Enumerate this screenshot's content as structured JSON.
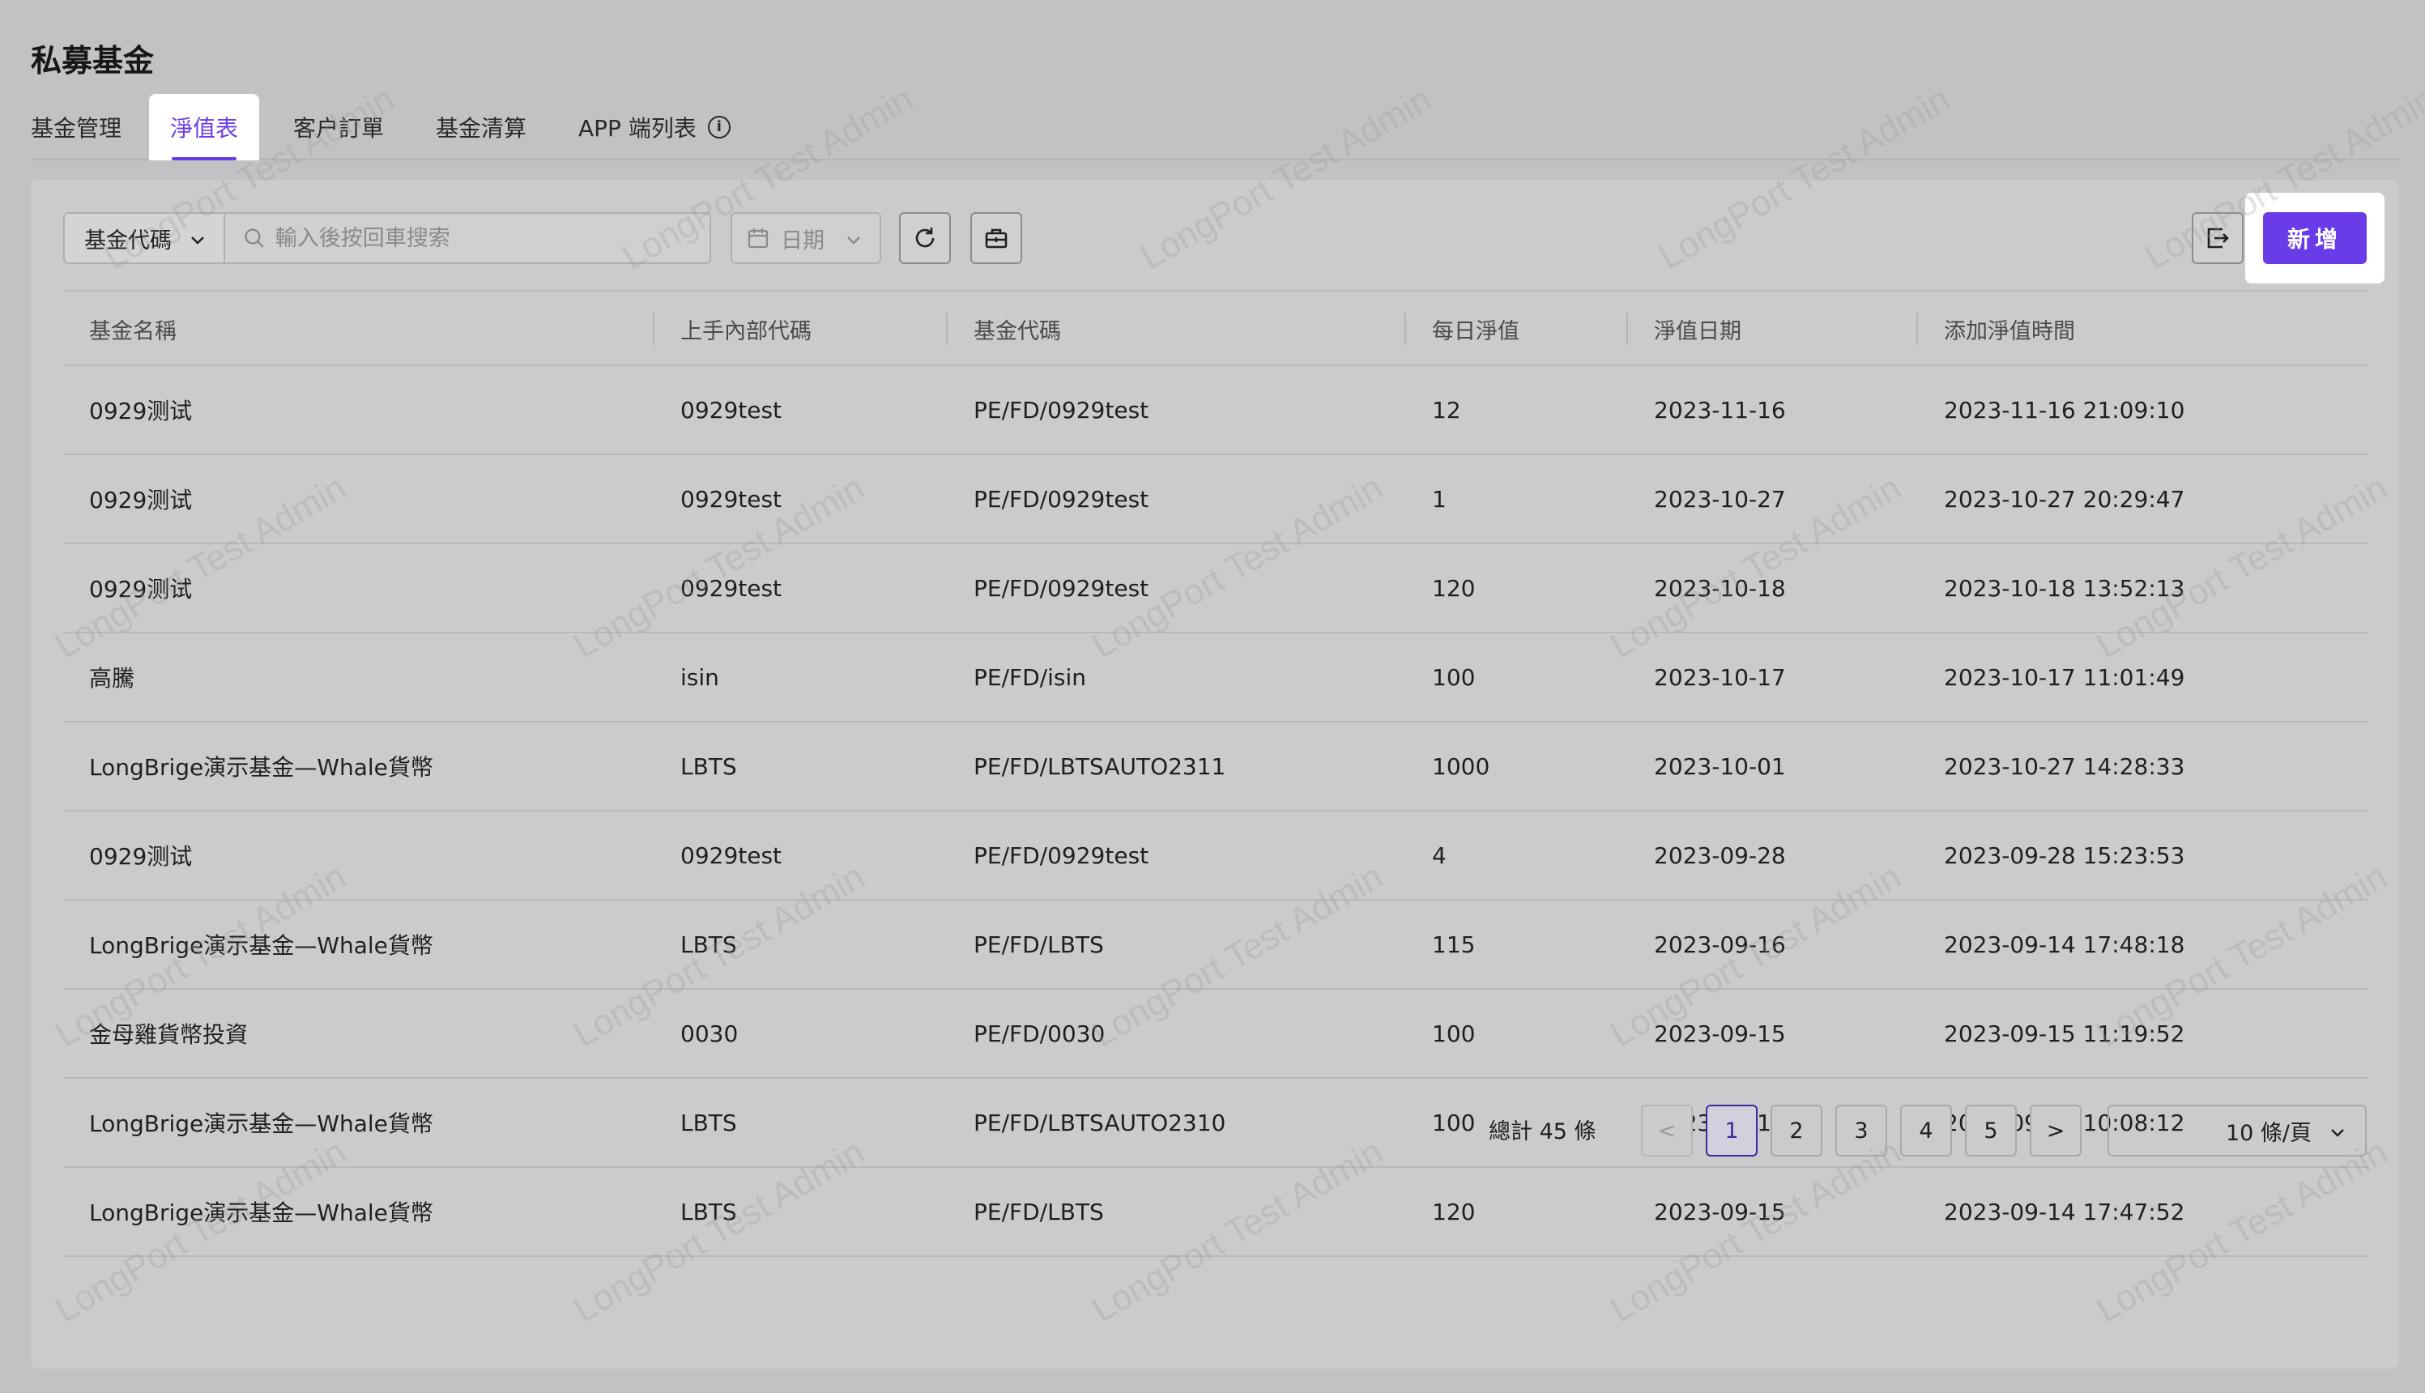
{
  "page_title": "私募基金",
  "tabs": [
    {
      "label": "基金管理",
      "active": false
    },
    {
      "label": "淨值表",
      "active": true
    },
    {
      "label": "客户訂單",
      "active": false
    },
    {
      "label": "基金清算",
      "active": false
    },
    {
      "label": "APP 端列表",
      "active": false
    }
  ],
  "toolbar": {
    "filter_select": "基金代碼",
    "search_placeholder": "輸入後按回車搜索",
    "date_label": "日期",
    "add_label": "新增"
  },
  "table": {
    "columns": [
      "基金名稱",
      "上手內部代碼",
      "基金代碼",
      "每日淨值",
      "淨值日期",
      "添加淨值時間"
    ],
    "rows": [
      [
        "0929测试",
        "0929test",
        "PE/FD/0929test",
        "12",
        "2023-11-16",
        "2023-11-16 21:09:10"
      ],
      [
        "0929测试",
        "0929test",
        "PE/FD/0929test",
        "1",
        "2023-10-27",
        "2023-10-27 20:29:47"
      ],
      [
        "0929测试",
        "0929test",
        "PE/FD/0929test",
        "120",
        "2023-10-18",
        "2023-10-18 13:52:13"
      ],
      [
        "高騰",
        "isin",
        "PE/FD/isin",
        "100",
        "2023-10-17",
        "2023-10-17 11:01:49"
      ],
      [
        "LongBrige演示基金—Whale貨幣",
        "LBTS",
        "PE/FD/LBTSAUTO2311",
        "1000",
        "2023-10-01",
        "2023-10-27 14:28:33"
      ],
      [
        "0929测试",
        "0929test",
        "PE/FD/0929test",
        "4",
        "2023-09-28",
        "2023-09-28 15:23:53"
      ],
      [
        "LongBrige演示基金—Whale貨幣",
        "LBTS",
        "PE/FD/LBTS",
        "115",
        "2023-09-16",
        "2023-09-14 17:48:18"
      ],
      [
        "金母雞貨幣投資",
        "0030",
        "PE/FD/0030",
        "100",
        "2023-09-15",
        "2023-09-15 11:19:52"
      ],
      [
        "LongBrige演示基金—Whale貨幣",
        "LBTS",
        "PE/FD/LBTSAUTO2310",
        "100",
        "2023-09-15",
        "2023-09-15 10:08:12"
      ],
      [
        "LongBrige演示基金—Whale貨幣",
        "LBTS",
        "PE/FD/LBTS",
        "120",
        "2023-09-15",
        "2023-09-14 17:47:52"
      ]
    ]
  },
  "pagination": {
    "total_label": "總計 45 條",
    "pages": [
      "1",
      "2",
      "3",
      "4",
      "5"
    ],
    "current": "1",
    "prev": "<",
    "next": ">",
    "page_size": "10 條/頁"
  },
  "watermark": "LongPort Test Admin",
  "colors": {
    "accent": "#6a3ce8",
    "background": "#c2c2c4"
  }
}
